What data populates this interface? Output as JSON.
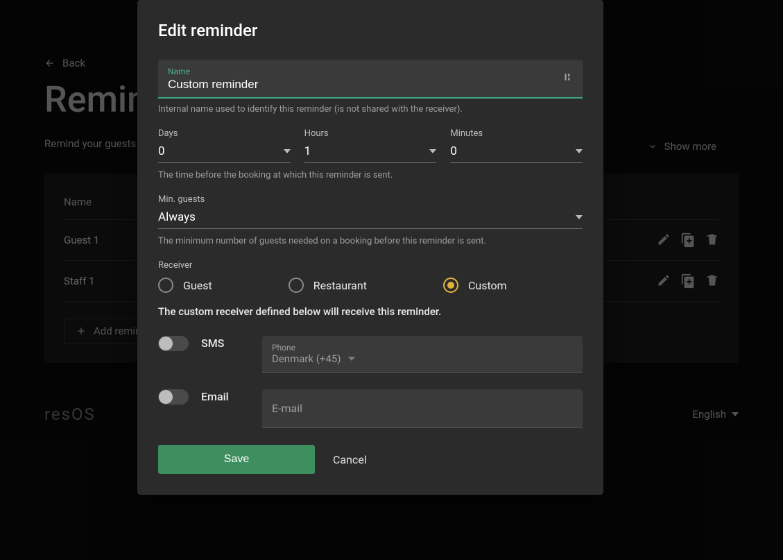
{
  "page": {
    "back_label": "Back",
    "title": "Reminders",
    "subtext": "Remind your guests about upcoming bookings.",
    "show_more_label": "Show more",
    "table": {
      "col_name": "Name",
      "rows": [
        {
          "name": "Guest 1"
        },
        {
          "name": "Staff 1"
        }
      ]
    },
    "add_btn_label": "Add reminder",
    "brand_text": "resOS",
    "lang_label": "English"
  },
  "modal": {
    "title": "Edit reminder",
    "name_label": "Name",
    "name_value": "Custom reminder",
    "name_hint": "Internal name used to identify this reminder (is not shared with the receiver).",
    "days_label": "Days",
    "days_value": "0",
    "hours_label": "Hours",
    "hours_value": "1",
    "minutes_label": "Minutes",
    "minutes_value": "0",
    "time_hint": "The time before the booking at which this reminder is sent.",
    "min_guests_label": "Min. guests",
    "min_guests_value": "Always",
    "min_guests_hint": "The minimum number of guests needed on a booking before this reminder is sent.",
    "receiver_label": "Receiver",
    "receiver_options": {
      "guest": "Guest",
      "restaurant": "Restaurant",
      "custom": "Custom"
    },
    "receiver_desc": "The custom receiver defined below will receive this reminder.",
    "sms_label": "SMS",
    "phone_label": "Phone",
    "phone_country": "Denmark (+45)",
    "email_toggle_label": "Email",
    "email_placeholder": "E-mail",
    "save_label": "Save",
    "cancel_label": "Cancel"
  }
}
